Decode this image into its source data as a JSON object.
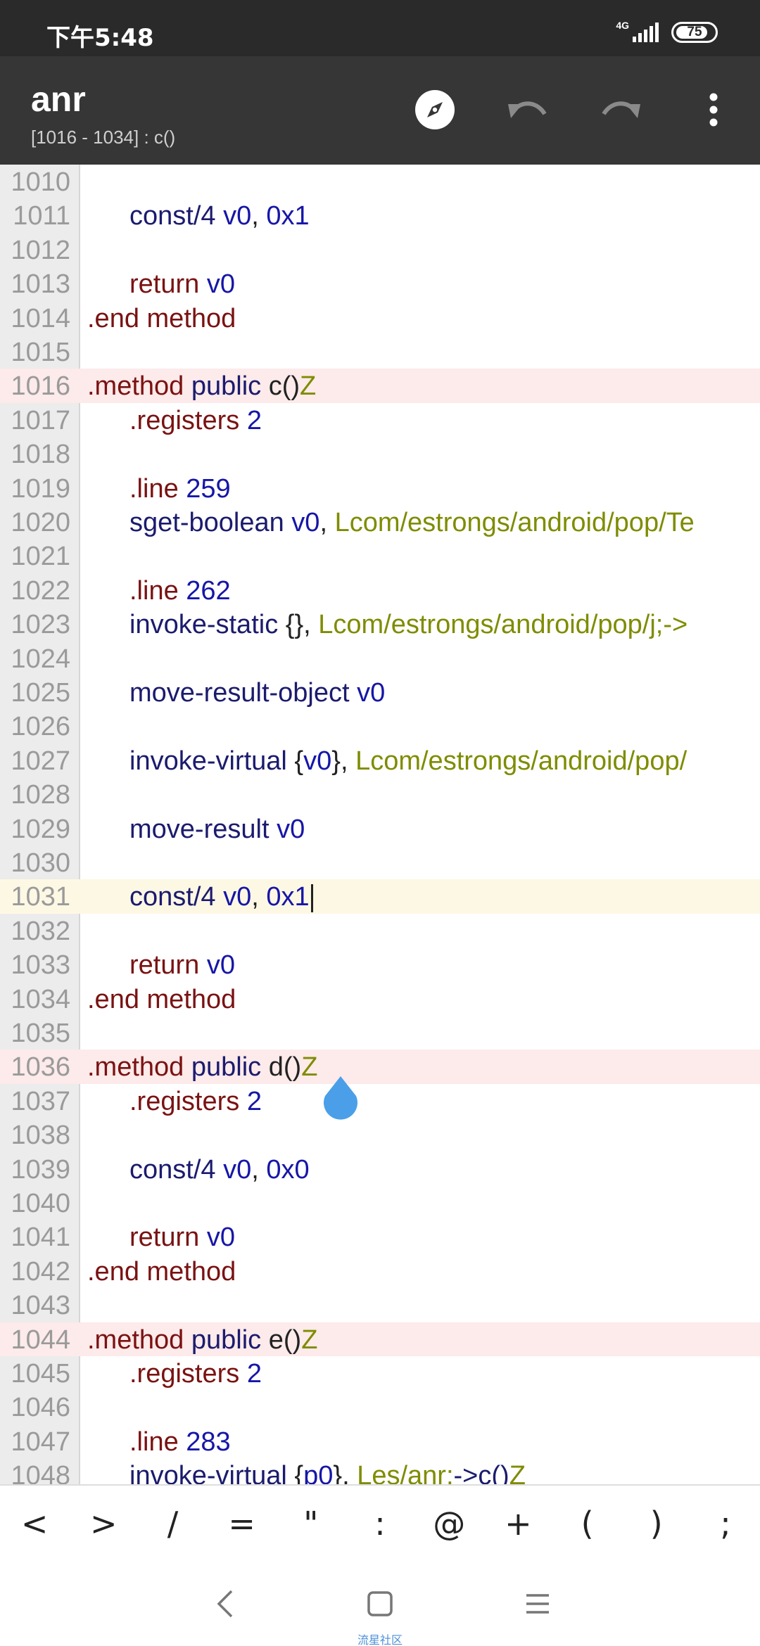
{
  "status_bar": {
    "time": "下午5:48",
    "network": "4G",
    "battery": "75"
  },
  "toolbar": {
    "title": "anr",
    "subtitle": "[1016 - 1034] : c()",
    "icons": [
      "compass-icon",
      "undo-icon",
      "redo-icon",
      "more-vert-icon"
    ]
  },
  "editor": {
    "lines": [
      {
        "n": "1010",
        "hl": "",
        "tokens": []
      },
      {
        "n": "1011",
        "hl": "",
        "indent": true,
        "tokens": [
          [
            "op",
            "const/4"
          ],
          [
            "plain",
            " "
          ],
          [
            "reg",
            "v0"
          ],
          [
            "plain",
            ", "
          ],
          [
            "num",
            "0x1"
          ]
        ]
      },
      {
        "n": "1012",
        "hl": "",
        "tokens": []
      },
      {
        "n": "1013",
        "hl": "",
        "indent": true,
        "tokens": [
          [
            "kw",
            "return"
          ],
          [
            "plain",
            " "
          ],
          [
            "reg",
            "v0"
          ]
        ]
      },
      {
        "n": "1014",
        "hl": "",
        "tokens": [
          [
            "kw",
            ".end"
          ],
          [
            "plain",
            " "
          ],
          [
            "kw",
            "method"
          ]
        ]
      },
      {
        "n": "1015",
        "hl": "",
        "tokens": []
      },
      {
        "n": "1016",
        "hl": "method",
        "tokens": [
          [
            "kw",
            ".method"
          ],
          [
            "plain",
            " "
          ],
          [
            "op",
            "public"
          ],
          [
            "plain",
            " "
          ],
          [
            "plain",
            "c()"
          ],
          [
            "typ",
            "Z"
          ]
        ]
      },
      {
        "n": "1017",
        "hl": "",
        "indent": true,
        "tokens": [
          [
            "kw",
            ".registers"
          ],
          [
            "plain",
            " "
          ],
          [
            "num",
            "2"
          ]
        ]
      },
      {
        "n": "1018",
        "hl": "",
        "tokens": []
      },
      {
        "n": "1019",
        "hl": "",
        "indent": true,
        "tokens": [
          [
            "kw",
            ".line"
          ],
          [
            "plain",
            " "
          ],
          [
            "num",
            "259"
          ]
        ]
      },
      {
        "n": "1020",
        "hl": "",
        "indent": true,
        "tokens": [
          [
            "op",
            "sget-boolean"
          ],
          [
            "plain",
            " "
          ],
          [
            "reg",
            "v0"
          ],
          [
            "plain",
            ", "
          ],
          [
            "typ",
            "Lcom/estrongs/android/pop/Te"
          ]
        ]
      },
      {
        "n": "1021",
        "hl": "",
        "tokens": []
      },
      {
        "n": "1022",
        "hl": "",
        "indent": true,
        "tokens": [
          [
            "kw",
            ".line"
          ],
          [
            "plain",
            " "
          ],
          [
            "num",
            "262"
          ]
        ]
      },
      {
        "n": "1023",
        "hl": "",
        "indent": true,
        "tokens": [
          [
            "op",
            "invoke-static"
          ],
          [
            "plain",
            " {}, "
          ],
          [
            "typ",
            "Lcom/estrongs/android/pop/j;->"
          ]
        ]
      },
      {
        "n": "1024",
        "hl": "",
        "tokens": []
      },
      {
        "n": "1025",
        "hl": "",
        "indent": true,
        "tokens": [
          [
            "op",
            "move-result-object"
          ],
          [
            "plain",
            " "
          ],
          [
            "reg",
            "v0"
          ]
        ]
      },
      {
        "n": "1026",
        "hl": "",
        "tokens": []
      },
      {
        "n": "1027",
        "hl": "",
        "indent": true,
        "tokens": [
          [
            "op",
            "invoke-virtual"
          ],
          [
            "plain",
            " {"
          ],
          [
            "reg",
            "v0"
          ],
          [
            "plain",
            "}, "
          ],
          [
            "typ",
            "Lcom/estrongs/android/pop/"
          ]
        ]
      },
      {
        "n": "1028",
        "hl": "",
        "tokens": []
      },
      {
        "n": "1029",
        "hl": "",
        "indent": true,
        "tokens": [
          [
            "op",
            "move-result"
          ],
          [
            "plain",
            " "
          ],
          [
            "reg",
            "v0"
          ]
        ]
      },
      {
        "n": "1030",
        "hl": "",
        "tokens": []
      },
      {
        "n": "1031",
        "hl": "cursor",
        "indent": true,
        "caret": true,
        "tokens": [
          [
            "op",
            "const/4"
          ],
          [
            "plain",
            " "
          ],
          [
            "reg",
            "v0"
          ],
          [
            "plain",
            ", "
          ],
          [
            "num",
            "0x1"
          ]
        ]
      },
      {
        "n": "1032",
        "hl": "",
        "tokens": []
      },
      {
        "n": "1033",
        "hl": "",
        "indent": true,
        "tokens": [
          [
            "kw",
            "return"
          ],
          [
            "plain",
            " "
          ],
          [
            "reg",
            "v0"
          ]
        ]
      },
      {
        "n": "1034",
        "hl": "",
        "tokens": [
          [
            "kw",
            ".end"
          ],
          [
            "plain",
            " "
          ],
          [
            "kw",
            "method"
          ]
        ]
      },
      {
        "n": "1035",
        "hl": "",
        "tokens": []
      },
      {
        "n": "1036",
        "hl": "method",
        "tokens": [
          [
            "kw",
            ".method"
          ],
          [
            "plain",
            " "
          ],
          [
            "op",
            "public"
          ],
          [
            "plain",
            " "
          ],
          [
            "plain",
            "d()"
          ],
          [
            "typ",
            "Z"
          ]
        ]
      },
      {
        "n": "1037",
        "hl": "",
        "indent": true,
        "tokens": [
          [
            "kw",
            ".registers"
          ],
          [
            "plain",
            " "
          ],
          [
            "num",
            "2"
          ]
        ]
      },
      {
        "n": "1038",
        "hl": "",
        "tokens": []
      },
      {
        "n": "1039",
        "hl": "",
        "indent": true,
        "tokens": [
          [
            "op",
            "const/4"
          ],
          [
            "plain",
            " "
          ],
          [
            "reg",
            "v0"
          ],
          [
            "plain",
            ", "
          ],
          [
            "num",
            "0x0"
          ]
        ]
      },
      {
        "n": "1040",
        "hl": "",
        "tokens": []
      },
      {
        "n": "1041",
        "hl": "",
        "indent": true,
        "tokens": [
          [
            "kw",
            "return"
          ],
          [
            "plain",
            " "
          ],
          [
            "reg",
            "v0"
          ]
        ]
      },
      {
        "n": "1042",
        "hl": "",
        "tokens": [
          [
            "kw",
            ".end"
          ],
          [
            "plain",
            " "
          ],
          [
            "kw",
            "method"
          ]
        ]
      },
      {
        "n": "1043",
        "hl": "",
        "tokens": []
      },
      {
        "n": "1044",
        "hl": "method",
        "tokens": [
          [
            "kw",
            ".method"
          ],
          [
            "plain",
            " "
          ],
          [
            "op",
            "public"
          ],
          [
            "plain",
            " "
          ],
          [
            "plain",
            "e()"
          ],
          [
            "typ",
            "Z"
          ]
        ]
      },
      {
        "n": "1045",
        "hl": "",
        "indent": true,
        "tokens": [
          [
            "kw",
            ".registers"
          ],
          [
            "plain",
            " "
          ],
          [
            "num",
            "2"
          ]
        ]
      },
      {
        "n": "1046",
        "hl": "",
        "tokens": []
      },
      {
        "n": "1047",
        "hl": "",
        "indent": true,
        "tokens": [
          [
            "kw",
            ".line"
          ],
          [
            "plain",
            " "
          ],
          [
            "num",
            "283"
          ]
        ]
      },
      {
        "n": "1048",
        "hl": "",
        "indent": true,
        "tokens": [
          [
            "op",
            "invoke-virtual"
          ],
          [
            "plain",
            " {"
          ],
          [
            "reg",
            "p0"
          ],
          [
            "plain",
            "}, "
          ],
          [
            "typ",
            "Les/anr;"
          ],
          [
            "op",
            "->c()"
          ],
          [
            "typ",
            "Z"
          ]
        ]
      }
    ]
  },
  "symbol_keys": [
    "<",
    ">",
    "/",
    "=",
    "\"",
    ":",
    "@",
    "+",
    "(",
    ")",
    ";"
  ],
  "navbar": {
    "watermark": "流星社区"
  },
  "colors": {
    "status_bar": "#2a2a2a",
    "toolbar": "#363636",
    "cursor_handle": "#4a9fe8",
    "method_highlight": "#fdeaea",
    "cursor_line": "#fdf8e4"
  }
}
